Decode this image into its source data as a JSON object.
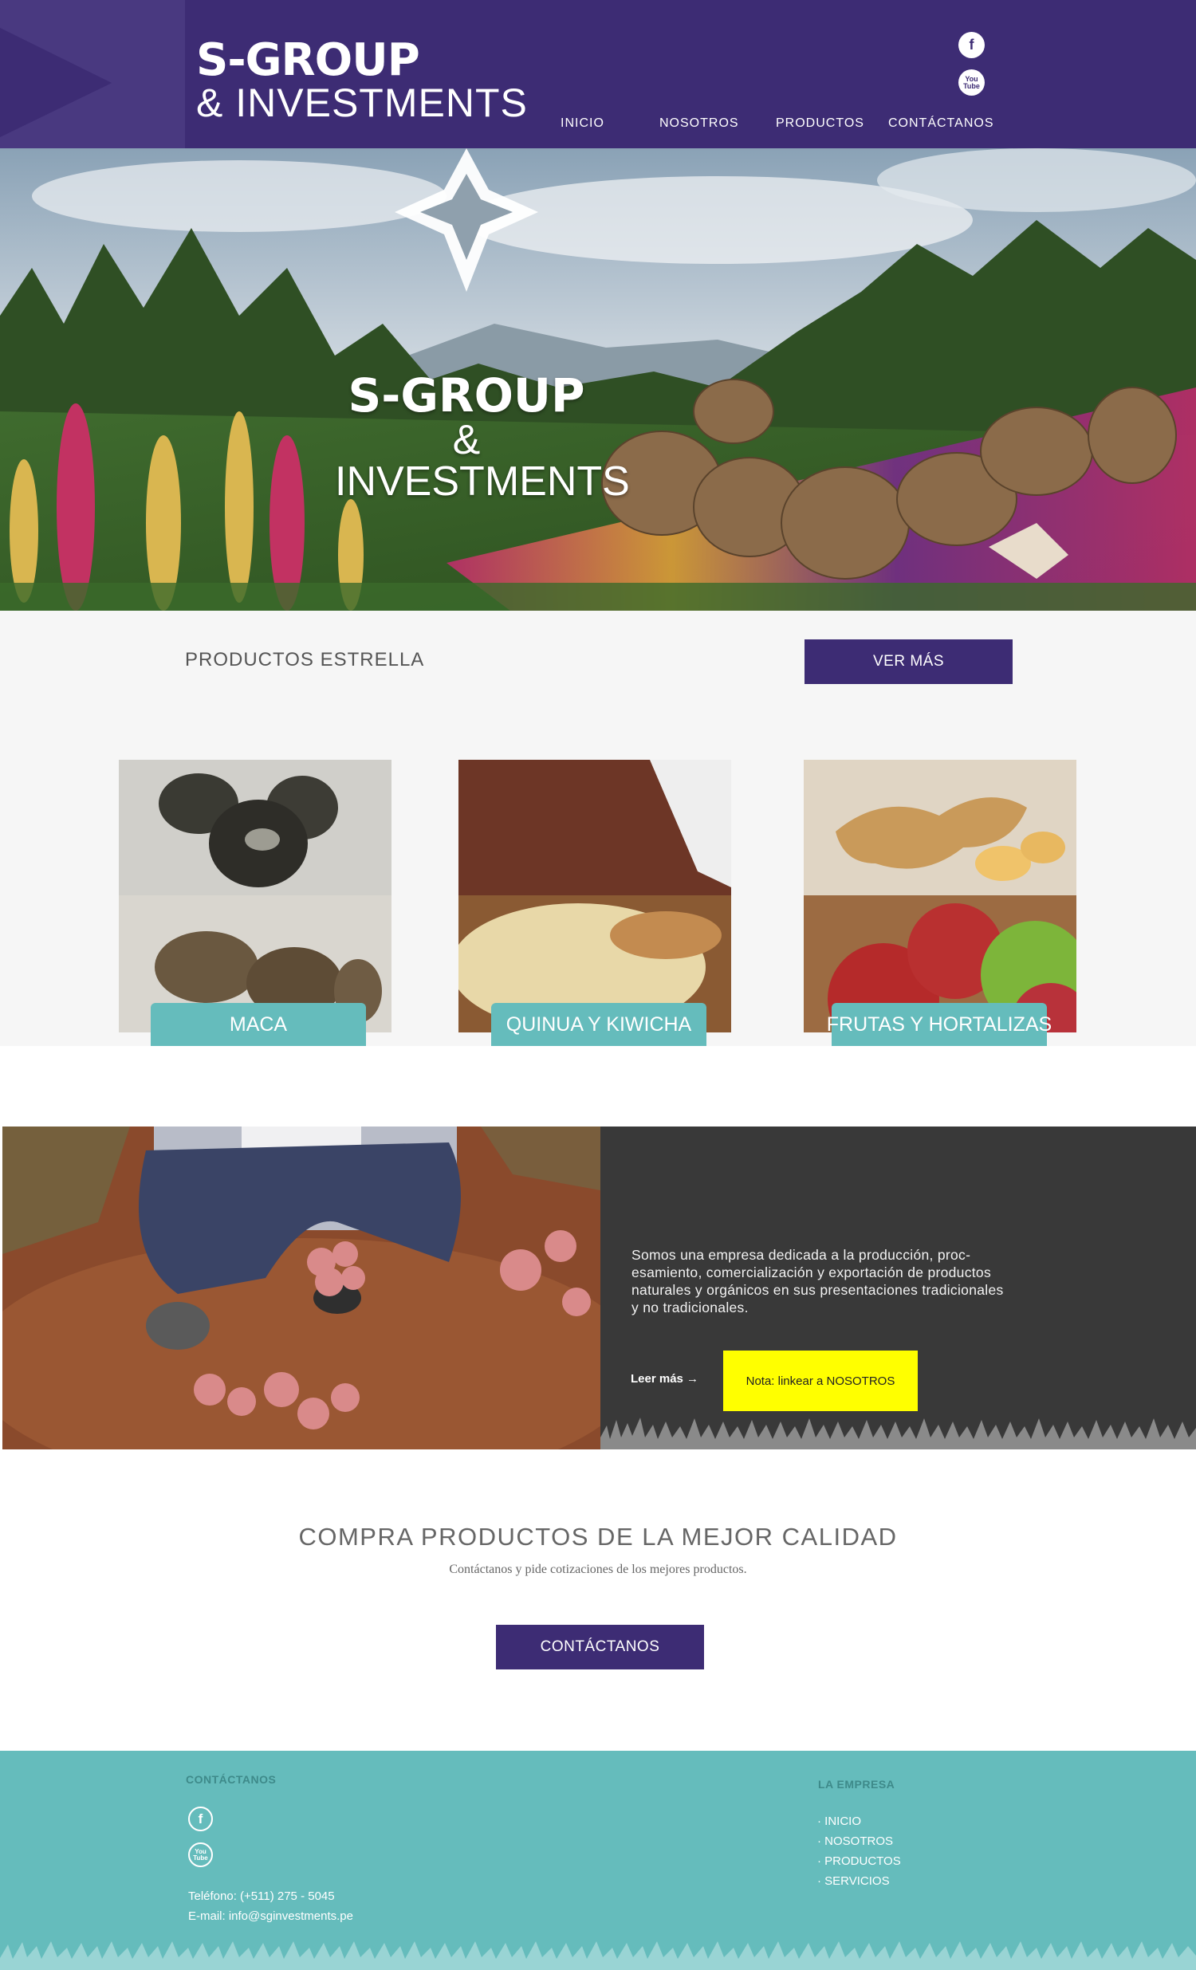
{
  "header": {
    "logo_line1": "S-GROUP",
    "logo_line2": "& INVESTMENTS",
    "social": {
      "facebook": "f",
      "youtube_line1": "You",
      "youtube_line2": "Tube"
    },
    "nav": [
      {
        "label": "INICIO"
      },
      {
        "label": "NOSOTROS"
      },
      {
        "label": "PRODUCTOS"
      },
      {
        "label": "CONTÁCTANOS"
      }
    ]
  },
  "hero": {
    "logo_line1": "S-GROUP",
    "logo_line2": "& INVESTMENTS"
  },
  "products": {
    "title": "PRODUCTOS ESTRELLA",
    "ver_mas": "VER MÁS",
    "cards": [
      {
        "label": "MACA"
      },
      {
        "label": "QUINUA Y KIWICHA"
      },
      {
        "label": "FRUTAS Y HORTALIZAS"
      }
    ]
  },
  "about": {
    "text": "Somos una empresa dedicada a la producción, proc-esamiento,  comercialización y exportación de productos naturales y orgánicos en sus presentaciones tradicionales y no tradicionales.",
    "leer_mas": "Leer más  →",
    "nota": "Nota:  linkear a NOSOTROS"
  },
  "cta": {
    "title": "COMPRA PRODUCTOS DE LA MEJOR CALIDAD",
    "subtitle": "Contáctanos y pide cotizaciones de los mejores productos.",
    "button": "CONTÁCTANOS"
  },
  "footer": {
    "contact_heading": "CONTÁCTANOS",
    "phone": "Teléfono: (+511) 275 - 5045",
    "email": "E-mail: info@sginvestments.pe",
    "company_heading": "LA EMPRESA",
    "links": [
      "· INICIO",
      "· NOSOTROS",
      "· PRODUCTOS",
      "· SERVICIOS"
    ]
  },
  "colors": {
    "brand_purple": "#3d2c74",
    "teal": "#65bcbc",
    "dark": "#393939",
    "note_yellow": "#ffff00"
  }
}
